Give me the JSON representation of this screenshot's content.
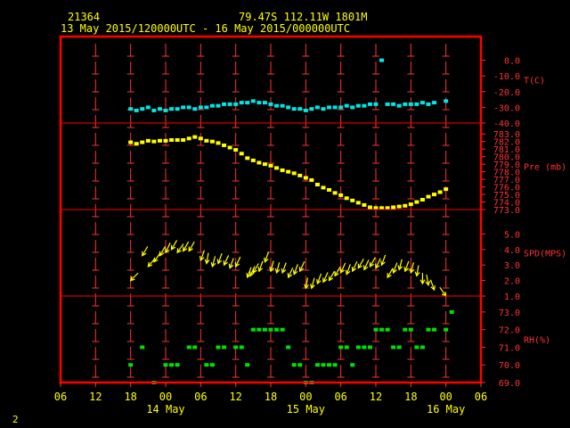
{
  "header": {
    "station": "21364",
    "coords": "79.47S  112.11W  1801M",
    "period": "13 May 2015/120000UTC - 16 May 2015/000000UTC"
  },
  "footer": {
    "page_number": "2"
  },
  "colors": {
    "frame": "#ff0000",
    "grid": "#ff3333",
    "text": "#ffff00",
    "temperature": "#00e5e5",
    "pressure": "#ffff00",
    "wind": "#ffff00",
    "humidity": "#00e000"
  },
  "chart_data": {
    "type": "scatter",
    "x_unit": "hours from 13 May 2015 06 UTC",
    "x_range": [
      0,
      72
    ],
    "x_ticks": [
      "06",
      "12",
      "18",
      "00",
      "06",
      "12",
      "18",
      "00",
      "06",
      "12",
      "18",
      "00",
      "06"
    ],
    "x_tick_hours": [
      0,
      6,
      12,
      18,
      24,
      30,
      36,
      42,
      48,
      54,
      60,
      66,
      72
    ],
    "day_labels": [
      {
        "label": "14 May",
        "hour": 18
      },
      {
        "label": "15 May",
        "hour": 42
      },
      {
        "label": "16 May",
        "hour": 66
      }
    ],
    "panels": [
      {
        "id": "temperature",
        "label": "T(C)",
        "range": [
          -40,
          10
        ],
        "ticks": [
          "0.0",
          "-10.0",
          "-20.0",
          "-30.0",
          "-40.0"
        ],
        "tick_values": [
          0,
          -10,
          -20,
          -30,
          -40
        ],
        "series": [
          {
            "x": 12,
            "y": -31
          },
          {
            "x": 13,
            "y": -32
          },
          {
            "x": 14,
            "y": -31
          },
          {
            "x": 15,
            "y": -30
          },
          {
            "x": 16,
            "y": -32
          },
          {
            "x": 17,
            "y": -31
          },
          {
            "x": 18,
            "y": -32
          },
          {
            "x": 19,
            "y": -31
          },
          {
            "x": 20,
            "y": -31
          },
          {
            "x": 21,
            "y": -30
          },
          {
            "x": 22,
            "y": -30
          },
          {
            "x": 23,
            "y": -31
          },
          {
            "x": 24,
            "y": -30
          },
          {
            "x": 25,
            "y": -30
          },
          {
            "x": 26,
            "y": -29
          },
          {
            "x": 27,
            "y": -29
          },
          {
            "x": 28,
            "y": -28
          },
          {
            "x": 29,
            "y": -28
          },
          {
            "x": 30,
            "y": -28
          },
          {
            "x": 31,
            "y": -27
          },
          {
            "x": 32,
            "y": -27
          },
          {
            "x": 33,
            "y": -26
          },
          {
            "x": 34,
            "y": -27
          },
          {
            "x": 35,
            "y": -27
          },
          {
            "x": 36,
            "y": -28
          },
          {
            "x": 37,
            "y": -29
          },
          {
            "x": 38,
            "y": -29
          },
          {
            "x": 39,
            "y": -30
          },
          {
            "x": 40,
            "y": -31
          },
          {
            "x": 41,
            "y": -31
          },
          {
            "x": 42,
            "y": -32
          },
          {
            "x": 43,
            "y": -31
          },
          {
            "x": 44,
            "y": -30
          },
          {
            "x": 45,
            "y": -31
          },
          {
            "x": 46,
            "y": -30
          },
          {
            "x": 47,
            "y": -30
          },
          {
            "x": 48,
            "y": -30
          },
          {
            "x": 49,
            "y": -29
          },
          {
            "x": 50,
            "y": -30
          },
          {
            "x": 51,
            "y": -29
          },
          {
            "x": 52,
            "y": -29
          },
          {
            "x": 53,
            "y": -28
          },
          {
            "x": 54,
            "y": -28
          },
          {
            "x": 55,
            "y": 0
          },
          {
            "x": 56,
            "y": -28
          },
          {
            "x": 57,
            "y": -28
          },
          {
            "x": 58,
            "y": -29
          },
          {
            "x": 59,
            "y": -28
          },
          {
            "x": 60,
            "y": -28
          },
          {
            "x": 61,
            "y": -28
          },
          {
            "x": 62,
            "y": -27
          },
          {
            "x": 63,
            "y": -28
          },
          {
            "x": 64,
            "y": -27
          },
          {
            "x": 66,
            "y": -26
          }
        ]
      },
      {
        "id": "pressure",
        "label": "Pre (mb)",
        "range": [
          773,
          783.5
        ],
        "ticks": [
          "783.0",
          "782.0",
          "781.0",
          "780.0",
          "779.0",
          "778.0",
          "777.0",
          "776.0",
          "775.0",
          "774.0",
          "773.0"
        ],
        "tick_values": [
          783,
          782,
          781,
          780,
          779,
          778,
          777,
          776,
          775,
          774,
          773
        ],
        "series": [
          {
            "x": 12,
            "y": 781.9
          },
          {
            "x": 13,
            "y": 781.7
          },
          {
            "x": 14,
            "y": 781.9
          },
          {
            "x": 15,
            "y": 782.1
          },
          {
            "x": 16,
            "y": 782.0
          },
          {
            "x": 17,
            "y": 782.1
          },
          {
            "x": 18,
            "y": 782.1
          },
          {
            "x": 19,
            "y": 782.2
          },
          {
            "x": 20,
            "y": 782.2
          },
          {
            "x": 21,
            "y": 782.2
          },
          {
            "x": 22,
            "y": 782.4
          },
          {
            "x": 23,
            "y": 782.6
          },
          {
            "x": 24,
            "y": 782.4
          },
          {
            "x": 25,
            "y": 782.1
          },
          {
            "x": 26,
            "y": 782.0
          },
          {
            "x": 27,
            "y": 781.8
          },
          {
            "x": 28,
            "y": 781.5
          },
          {
            "x": 29,
            "y": 781.2
          },
          {
            "x": 30,
            "y": 780.9
          },
          {
            "x": 31,
            "y": 780.4
          },
          {
            "x": 32,
            "y": 779.8
          },
          {
            "x": 33,
            "y": 779.5
          },
          {
            "x": 34,
            "y": 779.2
          },
          {
            "x": 35,
            "y": 779.0
          },
          {
            "x": 36,
            "y": 778.8
          },
          {
            "x": 37,
            "y": 778.5
          },
          {
            "x": 38,
            "y": 778.2
          },
          {
            "x": 39,
            "y": 778.0
          },
          {
            "x": 40,
            "y": 777.8
          },
          {
            "x": 41,
            "y": 777.5
          },
          {
            "x": 42,
            "y": 777.2
          },
          {
            "x": 43,
            "y": 776.9
          },
          {
            "x": 44,
            "y": 776.3
          },
          {
            "x": 45,
            "y": 775.9
          },
          {
            "x": 46,
            "y": 775.6
          },
          {
            "x": 47,
            "y": 775.2
          },
          {
            "x": 48,
            "y": 774.9
          },
          {
            "x": 49,
            "y": 774.5
          },
          {
            "x": 50,
            "y": 774.2
          },
          {
            "x": 51,
            "y": 773.9
          },
          {
            "x": 52,
            "y": 773.6
          },
          {
            "x": 53,
            "y": 773.3
          },
          {
            "x": 54,
            "y": 773.2
          },
          {
            "x": 55,
            "y": 773.2
          },
          {
            "x": 56,
            "y": 773.2
          },
          {
            "x": 57,
            "y": 773.3
          },
          {
            "x": 58,
            "y": 773.4
          },
          {
            "x": 59,
            "y": 773.5
          },
          {
            "x": 60,
            "y": 773.7
          },
          {
            "x": 61,
            "y": 774.0
          },
          {
            "x": 62,
            "y": 774.3
          },
          {
            "x": 63,
            "y": 774.7
          },
          {
            "x": 64,
            "y": 775.0
          },
          {
            "x": 65,
            "y": 775.3
          },
          {
            "x": 66,
            "y": 775.7
          }
        ]
      },
      {
        "id": "wind_speed",
        "label": "SPD(MPS)",
        "range": [
          1,
          6
        ],
        "ticks": [
          "5.0",
          "4.0",
          "3.0",
          "2.0",
          "1.0"
        ],
        "tick_values": [
          5,
          4,
          3,
          2,
          1
        ],
        "series": [
          {
            "x": 12,
            "y": 2.0,
            "dir": 225
          },
          {
            "x": 14,
            "y": 3.6,
            "dir": 210
          },
          {
            "x": 15,
            "y": 2.9,
            "dir": 220
          },
          {
            "x": 16,
            "y": 3.2,
            "dir": 215
          },
          {
            "x": 17,
            "y": 3.6,
            "dir": 210
          },
          {
            "x": 18,
            "y": 3.8,
            "dir": 205
          },
          {
            "x": 19,
            "y": 4.0,
            "dir": 210
          },
          {
            "x": 20,
            "y": 3.8,
            "dir": 215
          },
          {
            "x": 21,
            "y": 3.9,
            "dir": 210
          },
          {
            "x": 22,
            "y": 3.9,
            "dir": 210
          },
          {
            "x": 24,
            "y": 3.3,
            "dir": 200
          },
          {
            "x": 25,
            "y": 3.1,
            "dir": 190
          },
          {
            "x": 26,
            "y": 2.9,
            "dir": 195
          },
          {
            "x": 27,
            "y": 3.1,
            "dir": 200
          },
          {
            "x": 28,
            "y": 3.0,
            "dir": 205
          },
          {
            "x": 29,
            "y": 2.8,
            "dir": 200
          },
          {
            "x": 30,
            "y": 2.9,
            "dir": 205
          },
          {
            "x": 32,
            "y": 2.2,
            "dir": 200
          },
          {
            "x": 32.5,
            "y": 2.3,
            "dir": 205
          },
          {
            "x": 33,
            "y": 2.5,
            "dir": 210
          },
          {
            "x": 34,
            "y": 2.6,
            "dir": 200
          },
          {
            "x": 35,
            "y": 3.2,
            "dir": 200
          },
          {
            "x": 36,
            "y": 2.6,
            "dir": 195
          },
          {
            "x": 37,
            "y": 2.5,
            "dir": 195
          },
          {
            "x": 38,
            "y": 2.5,
            "dir": 200
          },
          {
            "x": 39,
            "y": 2.2,
            "dir": 205
          },
          {
            "x": 40,
            "y": 2.4,
            "dir": 200
          },
          {
            "x": 41,
            "y": 2.6,
            "dir": 205
          },
          {
            "x": 42,
            "y": 1.5,
            "dir": 190
          },
          {
            "x": 43,
            "y": 1.5,
            "dir": 195
          },
          {
            "x": 44,
            "y": 1.8,
            "dir": 200
          },
          {
            "x": 45,
            "y": 1.9,
            "dir": 205
          },
          {
            "x": 46,
            "y": 2.0,
            "dir": 210
          },
          {
            "x": 47,
            "y": 2.3,
            "dir": 210
          },
          {
            "x": 48,
            "y": 2.5,
            "dir": 205
          },
          {
            "x": 49,
            "y": 2.4,
            "dir": 200
          },
          {
            "x": 50,
            "y": 2.6,
            "dir": 205
          },
          {
            "x": 51,
            "y": 2.8,
            "dir": 210
          },
          {
            "x": 52,
            "y": 2.7,
            "dir": 205
          },
          {
            "x": 53,
            "y": 2.9,
            "dir": 210
          },
          {
            "x": 54,
            "y": 2.8,
            "dir": 205
          },
          {
            "x": 55,
            "y": 3.0,
            "dir": 200
          },
          {
            "x": 56,
            "y": 2.2,
            "dir": 210
          },
          {
            "x": 57,
            "y": 2.5,
            "dir": 200
          },
          {
            "x": 58,
            "y": 2.7,
            "dir": 195
          },
          {
            "x": 59,
            "y": 2.6,
            "dir": 200
          },
          {
            "x": 60,
            "y": 2.5,
            "dir": 195
          },
          {
            "x": 61,
            "y": 2.3,
            "dir": 190
          },
          {
            "x": 62,
            "y": 1.8,
            "dir": 180
          },
          {
            "x": 63,
            "y": 1.7,
            "dir": 170
          },
          {
            "x": 64,
            "y": 1.4,
            "dir": 160
          },
          {
            "x": 66,
            "y": 1.0,
            "dir": 145
          }
        ]
      },
      {
        "id": "humidity",
        "label": "RH(%)",
        "range": [
          69,
          73.5
        ],
        "ticks": [
          "73.0",
          "72.0",
          "71.0",
          "70.0",
          "69.0"
        ],
        "tick_values": [
          73,
          72,
          71,
          70,
          69
        ],
        "series": [
          {
            "x": 12,
            "y": 70
          },
          {
            "x": 14,
            "y": 71
          },
          {
            "x": 16,
            "y": 69
          },
          {
            "x": 18,
            "y": 70
          },
          {
            "x": 19,
            "y": 70
          },
          {
            "x": 20,
            "y": 70
          },
          {
            "x": 22,
            "y": 71
          },
          {
            "x": 23,
            "y": 71
          },
          {
            "x": 25,
            "y": 70
          },
          {
            "x": 26,
            "y": 70
          },
          {
            "x": 27,
            "y": 71
          },
          {
            "x": 28,
            "y": 71
          },
          {
            "x": 30,
            "y": 71
          },
          {
            "x": 31,
            "y": 71
          },
          {
            "x": 32,
            "y": 70
          },
          {
            "x": 33,
            "y": 72
          },
          {
            "x": 34,
            "y": 72
          },
          {
            "x": 35,
            "y": 72
          },
          {
            "x": 36,
            "y": 72
          },
          {
            "x": 37,
            "y": 72
          },
          {
            "x": 38,
            "y": 72
          },
          {
            "x": 39,
            "y": 71
          },
          {
            "x": 40,
            "y": 70
          },
          {
            "x": 41,
            "y": 70
          },
          {
            "x": 42,
            "y": 69
          },
          {
            "x": 43,
            "y": 69
          },
          {
            "x": 44,
            "y": 70
          },
          {
            "x": 45,
            "y": 70
          },
          {
            "x": 46,
            "y": 70
          },
          {
            "x": 47,
            "y": 70
          },
          {
            "x": 48,
            "y": 71
          },
          {
            "x": 49,
            "y": 71
          },
          {
            "x": 50,
            "y": 70
          },
          {
            "x": 51,
            "y": 71
          },
          {
            "x": 52,
            "y": 71
          },
          {
            "x": 53,
            "y": 71
          },
          {
            "x": 54,
            "y": 72
          },
          {
            "x": 55,
            "y": 72
          },
          {
            "x": 56,
            "y": 72
          },
          {
            "x": 57,
            "y": 71
          },
          {
            "x": 58,
            "y": 71
          },
          {
            "x": 59,
            "y": 72
          },
          {
            "x": 60,
            "y": 72
          },
          {
            "x": 61,
            "y": 71
          },
          {
            "x": 62,
            "y": 71
          },
          {
            "x": 63,
            "y": 72
          },
          {
            "x": 64,
            "y": 72
          },
          {
            "x": 66,
            "y": 72
          },
          {
            "x": 67,
            "y": 73
          }
        ]
      }
    ]
  }
}
